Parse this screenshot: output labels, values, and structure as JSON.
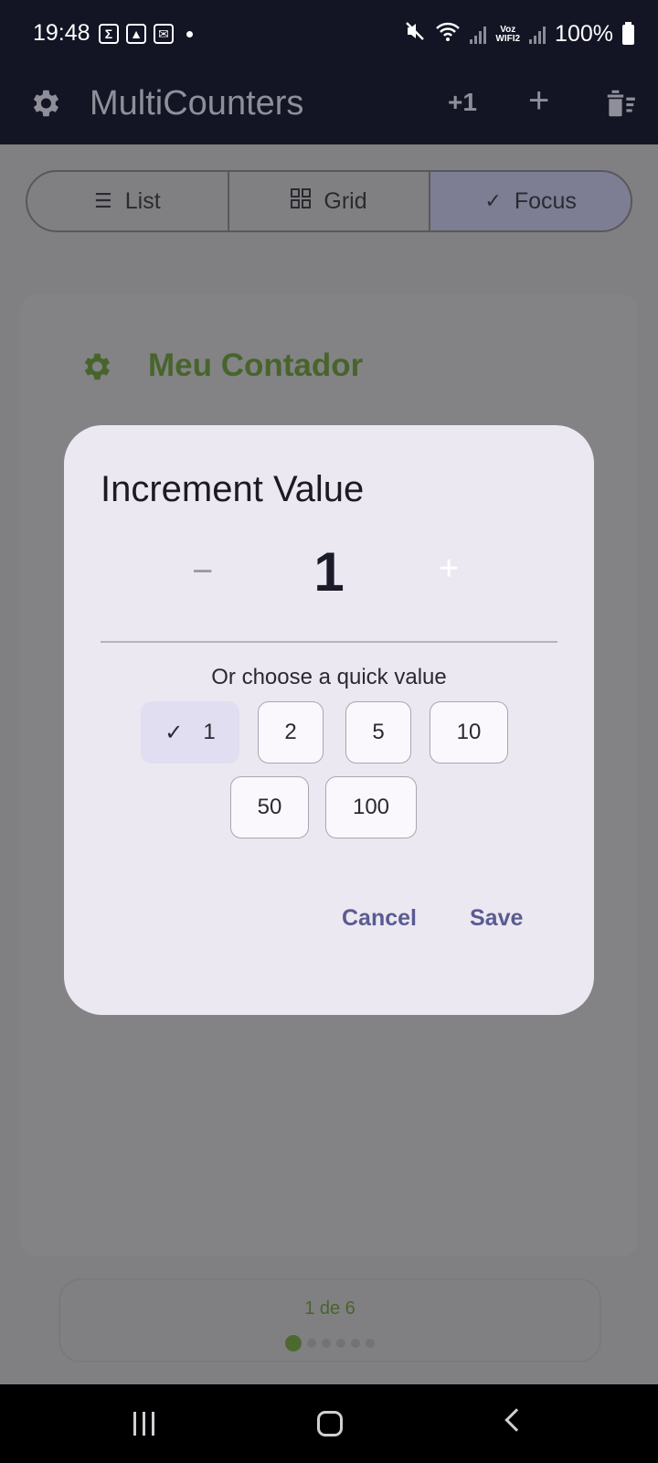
{
  "status_bar": {
    "time": "19:48",
    "battery": "100%",
    "voz_line1": "Voz",
    "voz_line2": "WIFI2",
    "left_icons": [
      "sigma-notification-icon",
      "image-notification-icon",
      "vpn-notification-icon",
      "dot-indicator-icon"
    ],
    "right_icons": [
      "mute-vibrate-icon",
      "wifi-icon",
      "signal-icon",
      "signal-icon",
      "battery-icon"
    ]
  },
  "app_bar": {
    "title": "MultiCounters",
    "increment_label": "+1",
    "add_label": "+",
    "icons": [
      "gear-icon",
      "trash-sort-icon"
    ]
  },
  "view_toggle": {
    "options": [
      {
        "label": "List",
        "icon": "list-icon",
        "selected": false
      },
      {
        "label": "Grid",
        "icon": "grid-icon",
        "selected": false
      },
      {
        "label": "Focus",
        "icon": "check-icon",
        "selected": true
      }
    ]
  },
  "counter_card": {
    "title": "Meu Contador",
    "pager_label": "1 de 6",
    "page_count": 6,
    "current_page": 1
  },
  "dialog": {
    "title": "Increment Value",
    "current_value": "1",
    "minus_label": "−",
    "plus_label": "+",
    "quick_label": "Or choose a quick value",
    "quick_values": [
      "1",
      "2",
      "5",
      "10",
      "50",
      "100"
    ],
    "selected_value": "1",
    "cancel_label": "Cancel",
    "save_label": "Save"
  },
  "colors": {
    "accent": "#5a5b92",
    "counter_green": "#48642c",
    "dialog_bg": "#ece8f1",
    "selected_chip": "#e1def1"
  }
}
